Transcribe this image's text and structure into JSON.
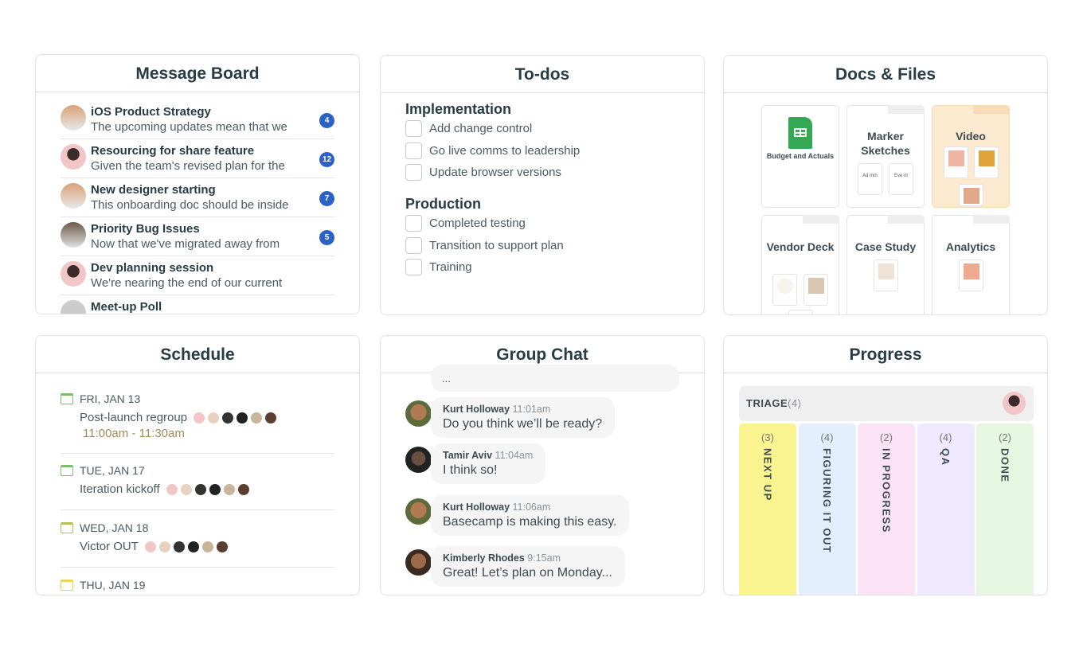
{
  "message_board": {
    "title": "Message Board",
    "items": [
      {
        "title": "iOS Product Strategy",
        "snippet": "The upcoming updates mean that we",
        "count": "4"
      },
      {
        "title": "Resourcing for share feature",
        "snippet": "Given the team's revised plan for the",
        "count": "12"
      },
      {
        "title": "New designer starting",
        "snippet": "This onboarding doc should be inside",
        "count": "7"
      },
      {
        "title": "Priority Bug Issues",
        "snippet": "Now that we've migrated away from",
        "count": "5"
      },
      {
        "title": "Dev planning session",
        "snippet": "We're nearing the end of our current",
        "count": ""
      },
      {
        "title": "Meet-up Poll",
        "snippet": "",
        "count": ""
      }
    ]
  },
  "todos": {
    "title": "To-dos",
    "lists": [
      {
        "name": "Implementation",
        "items": [
          "Add change control",
          "Go live comms to leadership",
          "Update browser versions"
        ]
      },
      {
        "name": "Production",
        "items": [
          "Completed testing",
          "Transition to support plan",
          "Training"
        ]
      }
    ]
  },
  "docs": {
    "title": "Docs & Files",
    "tiles": [
      {
        "name": "Budget and Actuals",
        "icon": "google-sheets-icon",
        "files": []
      },
      {
        "name": "Marker Sketches",
        "files": [
          "Ad min",
          "Eve nt"
        ]
      },
      {
        "name": "Video",
        "files": [
          "",
          "",
          ""
        ]
      },
      {
        "name": "Vendor Deck",
        "files": [
          "",
          "",
          ""
        ]
      },
      {
        "name": "Case Study",
        "files": [
          ""
        ]
      },
      {
        "name": "Analytics",
        "files": [
          ""
        ]
      }
    ]
  },
  "schedule": {
    "title": "Schedule",
    "events": [
      {
        "date": "FRI, JAN 13",
        "title": "Post-launch regroup",
        "time": "11:00am - 11:30am"
      },
      {
        "date": "TUE, JAN 17",
        "title": "Iteration kickoff",
        "time": ""
      },
      {
        "date": "WED, JAN 18",
        "title": "Victor OUT",
        "time": ""
      },
      {
        "date": "THU, JAN 19",
        "title": "",
        "time": ""
      }
    ]
  },
  "chat": {
    "title": "Group Chat",
    "truncated": "...",
    "messages": [
      {
        "author": "Kurt Holloway",
        "time": "11:01am",
        "text": "Do you think we’ll be ready?"
      },
      {
        "author": "Tamir Aviv",
        "time": "11:04am",
        "text": "I think so!"
      },
      {
        "author": "Kurt Holloway",
        "time": "11:06am",
        "text": "Basecamp is making this easy."
      },
      {
        "author": "Kimberly Rhodes",
        "time": "9:15am",
        "text": "Great! Let’s plan on Monday..."
      }
    ]
  },
  "progress": {
    "title": "Progress",
    "triage": {
      "label": "TRIAGE",
      "count": "(4)"
    },
    "columns": [
      {
        "label": "NEXT UP",
        "count": "(3)",
        "color": "#f9f48f"
      },
      {
        "label": "FIGURING IT OUT",
        "count": "(4)",
        "color": "#e3effc"
      },
      {
        "label": "IN PROGRESS",
        "count": "(2)",
        "color": "#fbe3f5"
      },
      {
        "label": "QA",
        "count": "(4)",
        "color": "#efeaff"
      },
      {
        "label": "DONE",
        "count": "(2)",
        "color": "#e6f7e1"
      }
    ]
  },
  "colors": {
    "badge": "#2b62c8",
    "video_folder": "#fbe9d0",
    "sheets_green": "#34a853"
  }
}
